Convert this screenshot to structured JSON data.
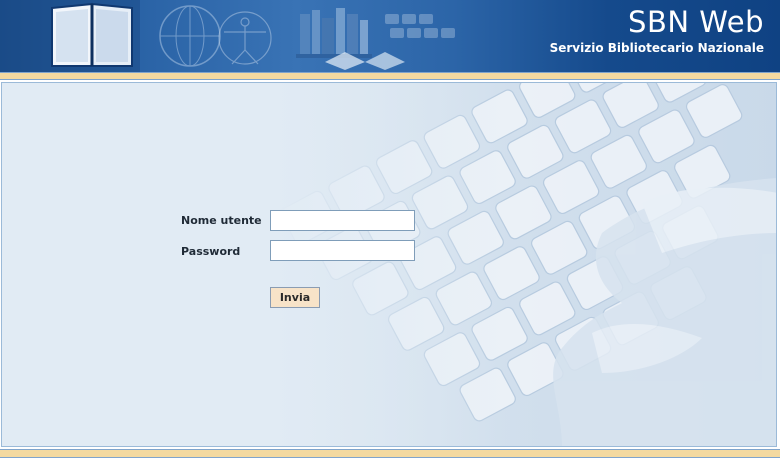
{
  "header": {
    "title": "SBN Web",
    "subtitle": "Servizio Bibliotecario Nazionale"
  },
  "login": {
    "username_label": "Nome utente",
    "username_value": "",
    "password_label": "Password",
    "password_value": "",
    "submit_label": "Invia"
  },
  "colors": {
    "header_blue": "#1f5a9c",
    "separator_bar": "#f3d9a0",
    "content_bg": "#e1ebf4",
    "button_bg": "#f7e3c8"
  }
}
